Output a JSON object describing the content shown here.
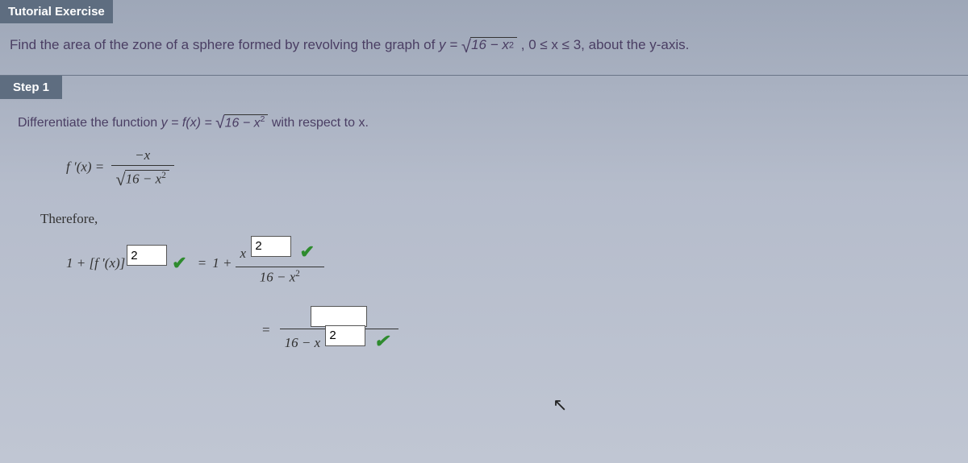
{
  "tutorial_header": "Tutorial Exercise",
  "problem": {
    "pre": "Find the area of the zone of a sphere formed by revolving the graph of ",
    "eq_lhs": "y = ",
    "radicand": "16 − x",
    "exp": "2",
    "range": ", 0 ≤ x ≤ 3,",
    "post": " about the y-axis."
  },
  "step_header": "Step 1",
  "step1": {
    "instruction_pre": "Differentiate the function ",
    "func_def": "y = f(x) = ",
    "radicand": "16 − x",
    "exp": "2",
    "instruction_post": " with respect to x."
  },
  "derivative": {
    "lhs": "f ′(x) = ",
    "numerator": "−x",
    "den_radicand": "16 − x",
    "den_exp": "2"
  },
  "therefore": "Therefore,",
  "line1": {
    "lhs_text": "1 + [f ′(x)]",
    "exp_value": "2",
    "eq": " = ",
    "rhs_pre": "1 + ",
    "num_x": "x",
    "num_exp_value": "2",
    "den_radicand": "16 − x",
    "den_exp": "2"
  },
  "line2": {
    "eq": "= ",
    "num_value": "",
    "den_pre": "16 − x",
    "den_exp_value": "2"
  }
}
